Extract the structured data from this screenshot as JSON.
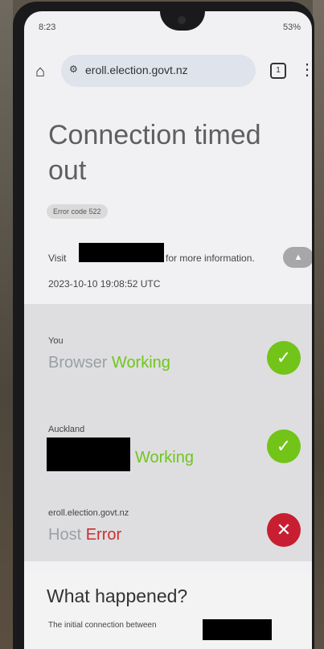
{
  "status_bar": {
    "time": "8:23",
    "battery": "53%"
  },
  "browser": {
    "url": "eroll.election.govt.nz",
    "tab_count": "1"
  },
  "error_page": {
    "title": "Connection timed out",
    "error_code": "Error code 522",
    "visit_prefix": "Visit",
    "visit_suffix": "for more information.",
    "timestamp": "2023-10-10 19:08:52 UTC"
  },
  "status_items": [
    {
      "location": "You",
      "name": "Browser",
      "state": "Working"
    },
    {
      "location": "Auckland",
      "name": "",
      "state": "Working"
    },
    {
      "location": "eroll.election.govt.nz",
      "name": "Host",
      "state": "Error"
    }
  ],
  "what_happened": {
    "title": "What happened?",
    "text": "The initial connection between"
  }
}
